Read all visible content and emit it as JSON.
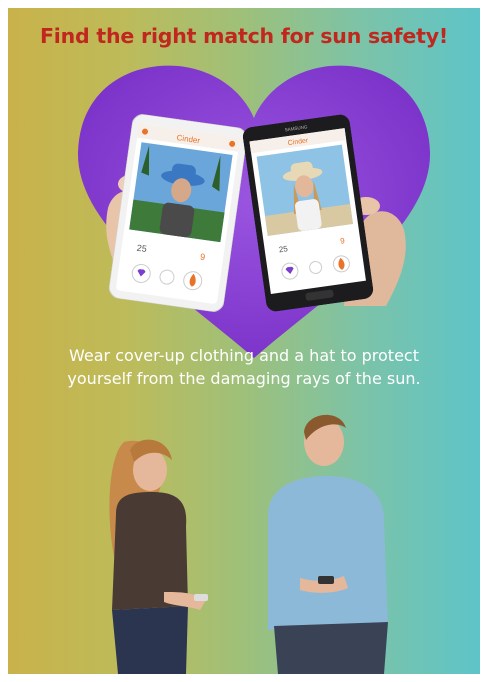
{
  "headline": "Find the right match for sun safety!",
  "message": {
    "line1": "Wear cover-up clothing and a hat to protect",
    "line2": "yourself from the damaging rays of the sun."
  },
  "app": {
    "brand": "Cinder",
    "phone_a_stats": {
      "left": "25",
      "right": "9"
    },
    "phone_b_stats": {
      "left": "25",
      "right": "9"
    },
    "phone_b_maker": "SAMSUNG"
  },
  "colors": {
    "headline": "#c0281f",
    "heart": "#8a3fd1",
    "accent_orange": "#e8742a",
    "like_purple": "#7b3fd0"
  }
}
